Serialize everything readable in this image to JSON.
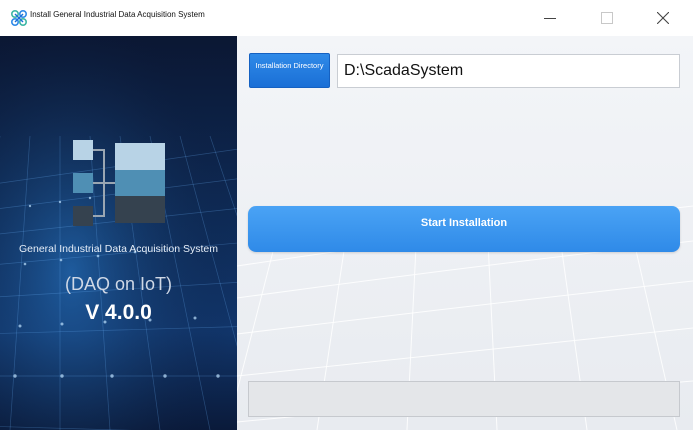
{
  "window": {
    "title": "Install General Industrial Data Acquisition System",
    "controls": {
      "minimize": "minimize",
      "maximize": "maximize",
      "close": "close"
    }
  },
  "left_panel": {
    "product_name": "General Industrial Data Acquisition System",
    "subtitle": "(DAQ on IoT)",
    "version": "V 4.0.0"
  },
  "installer": {
    "dir_button_label": "Installation Directory",
    "install_path": "D:\\ScadaSystem",
    "start_button_label": "Start Installation",
    "status_text": ""
  },
  "colors": {
    "accent": "#2f8ae8",
    "left_bg": "#0d1d3d",
    "right_bg": "#f2f4f7"
  },
  "icons": {
    "app": "app-logo-icon",
    "minimize": "minimize-icon",
    "maximize": "maximize-icon",
    "close": "close-icon"
  }
}
